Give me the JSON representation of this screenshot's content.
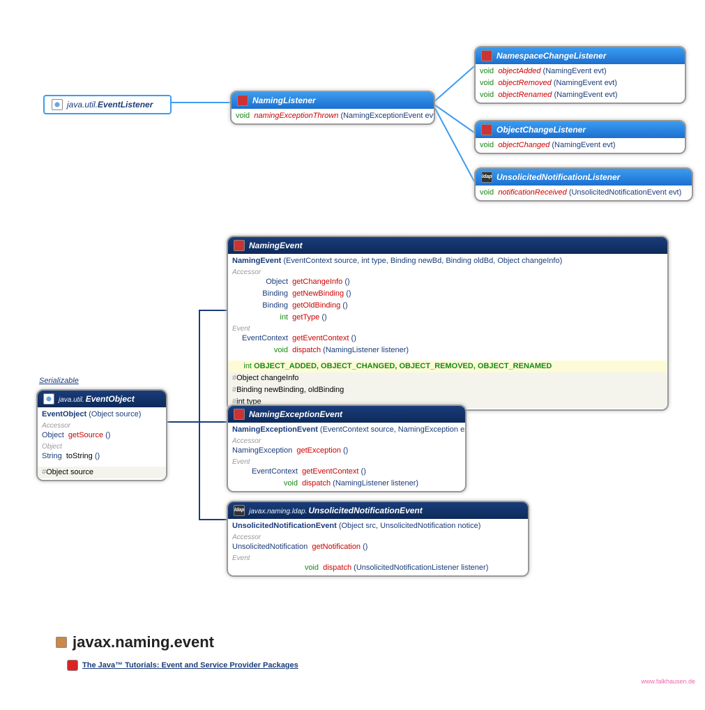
{
  "eventListener": {
    "pkg": "java.util.",
    "name": "EventListener"
  },
  "namingListener": {
    "name": "NamingListener",
    "methods": [
      {
        "ret": "void",
        "name": "namingExceptionThrown",
        "params": "(NamingExceptionEvent evt)"
      }
    ]
  },
  "namespaceChangeListener": {
    "name": "NamespaceChangeListener",
    "methods": [
      {
        "ret": "void",
        "name": "objectAdded",
        "params": "(NamingEvent evt)"
      },
      {
        "ret": "void",
        "name": "objectRemoved",
        "params": "(NamingEvent evt)"
      },
      {
        "ret": "void",
        "name": "objectRenamed",
        "params": "(NamingEvent evt)"
      }
    ]
  },
  "objectChangeListener": {
    "name": "ObjectChangeListener",
    "methods": [
      {
        "ret": "void",
        "name": "objectChanged",
        "params": "(NamingEvent evt)"
      }
    ]
  },
  "unsolicitedNotificationListener": {
    "name": "UnsolicitedNotificationListener",
    "methods": [
      {
        "ret": "void",
        "name": "notificationReceived",
        "params": "(UnsolicitedNotificationEvent evt)"
      }
    ]
  },
  "serializableLabel": "Serializable",
  "eventObject": {
    "pkg": "java.util.",
    "name": "EventObject",
    "ctor": {
      "name": "EventObject",
      "params": "(Object source)"
    },
    "accessor": [
      {
        "ret": "Object",
        "name": "getSource",
        "params": "()"
      }
    ],
    "object": [
      {
        "ret": "String",
        "name": "toString",
        "params": "()"
      }
    ],
    "fields": [
      {
        "sig": "Object source"
      }
    ]
  },
  "namingEvent": {
    "name": "NamingEvent",
    "ctor": {
      "name": "NamingEvent",
      "params": "(EventContext source, int type, Binding newBd, Binding oldBd, Object changeInfo)"
    },
    "accessor": [
      {
        "ret": "Object",
        "name": "getChangeInfo",
        "params": "()"
      },
      {
        "ret": "Binding",
        "name": "getNewBinding",
        "params": "()"
      },
      {
        "ret": "Binding",
        "name": "getOldBinding",
        "params": "()"
      },
      {
        "ret": "int",
        "name": "getType",
        "params": "()"
      }
    ],
    "event": [
      {
        "ret": "EventContext",
        "name": "getEventContext",
        "params": "()"
      },
      {
        "ret": "void",
        "name": "dispatch",
        "params": "(NamingListener listener)"
      }
    ],
    "constants": "OBJECT_ADDED, OBJECT_CHANGED, OBJECT_REMOVED, OBJECT_RENAMED",
    "constType": "int",
    "fields": [
      {
        "sig": "Object changeInfo"
      },
      {
        "sig": "Binding newBinding, oldBinding"
      },
      {
        "sig": "int type"
      }
    ]
  },
  "namingExceptionEvent": {
    "name": "NamingExceptionEvent",
    "ctor": {
      "name": "NamingExceptionEvent",
      "params": "(EventContext source, NamingException exc)"
    },
    "accessor": [
      {
        "ret": "NamingException",
        "name": "getException",
        "params": "()"
      }
    ],
    "event": [
      {
        "ret": "EventContext",
        "name": "getEventContext",
        "params": "()"
      },
      {
        "ret": "void",
        "name": "dispatch",
        "params": "(NamingListener listener)"
      }
    ]
  },
  "unsolicitedNotificationEvent": {
    "pkg": "javax.naming.ldap.",
    "name": "UnsolicitedNotificationEvent",
    "ctor": {
      "name": "UnsolicitedNotificationEvent",
      "params": "(Object src, UnsolicitedNotification notice)"
    },
    "accessor": [
      {
        "ret": "UnsolicitedNotification",
        "name": "getNotification",
        "params": "()"
      }
    ],
    "event": [
      {
        "ret": "void",
        "name": "dispatch",
        "params": "(UnsolicitedNotificationListener listener)"
      }
    ]
  },
  "packageName": "javax.naming.event",
  "tutorialLink": "The Java™ Tutorials: Event and Service Provider Packages",
  "watermark": "www.falkhausen.de",
  "labels": {
    "accessor": "Accessor",
    "event": "Event",
    "object": "Object"
  }
}
